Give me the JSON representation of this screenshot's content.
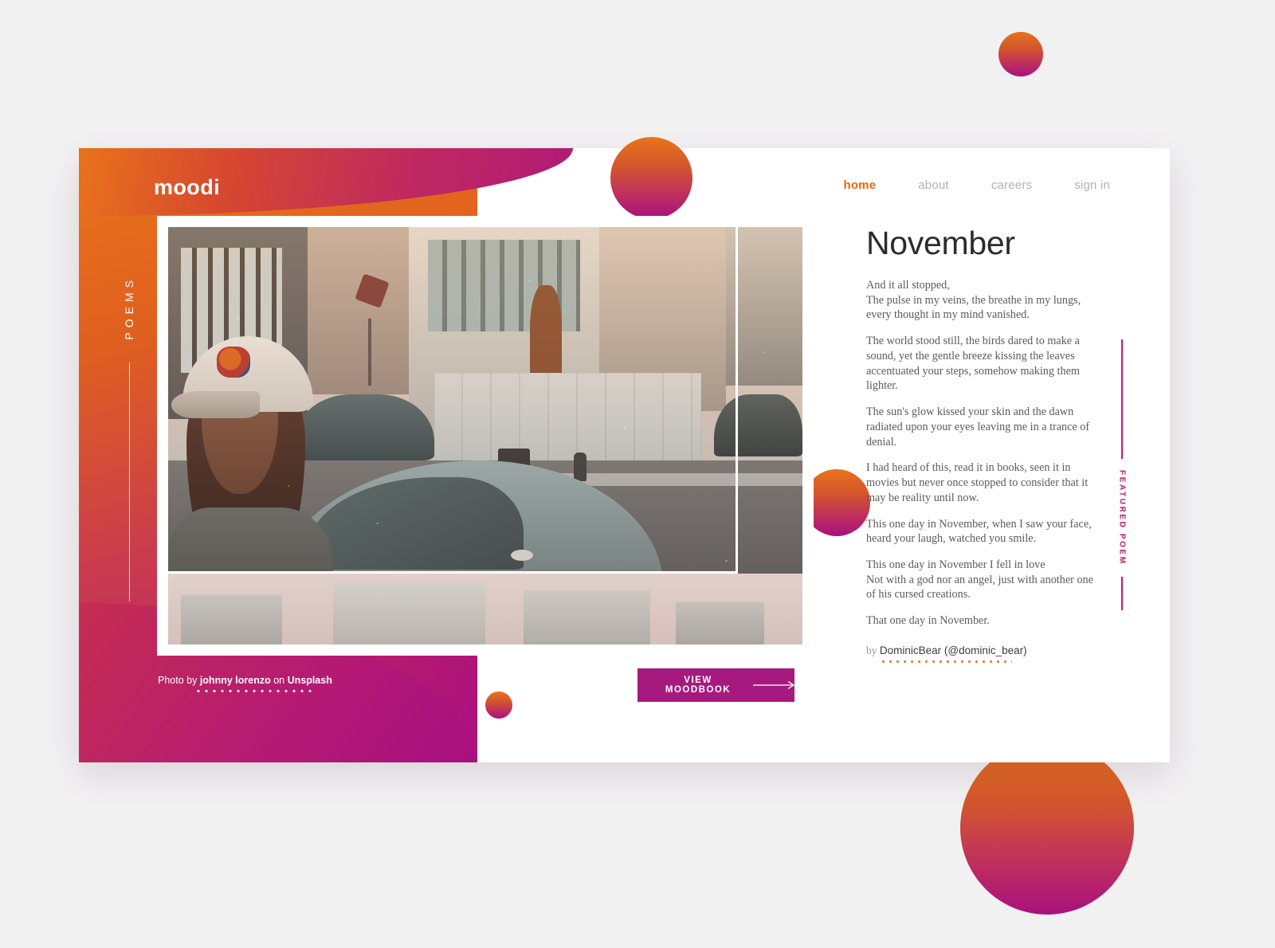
{
  "brand": "moodi",
  "side_rail": {
    "label": "POEMS"
  },
  "nav": {
    "items": [
      {
        "label": "home",
        "active": true
      },
      {
        "label": "about",
        "active": false
      },
      {
        "label": "careers",
        "active": false
      },
      {
        "label": "sign in",
        "active": false
      }
    ]
  },
  "photo_credit": {
    "prefix": "Photo by ",
    "photographer": "johnny lorenzo",
    "middle": " on ",
    "source": "Unsplash"
  },
  "cta": {
    "label": "VIEW MOODBOOK",
    "icon": "arrow-right-icon"
  },
  "featured": {
    "label": "FEATURED POEM"
  },
  "poem": {
    "title": "November",
    "stanzas": [
      "And it all stopped,\nThe pulse in my veins, the breathe in my lungs,\nevery thought in my mind vanished.",
      "The world stood still, the birds dared to make a sound, yet the gentle breeze kissing the leaves accentuated your steps, somehow making them lighter.",
      "The sun's glow kissed your skin and the dawn radiated upon your eyes leaving me in a trance of denial.",
      "I had heard of this, read it in books, seen it in movies but never once stopped to consider that it may be reality until now.",
      "This one day in November, when I saw your face, heard your laugh, watched you smile.",
      "This one day in November I fell in love\nNot with a god nor an angel, just with another one of his cursed creations.",
      "That one day in November."
    ],
    "by_prefix": "by ",
    "author": "DominicBear (@dominic_bear)"
  },
  "colors": {
    "accent_orange": "#ec6608",
    "accent_magenta": "#c2186f",
    "cta_bg": "#a61a7f",
    "page_bg": "#f2f1f2",
    "gradient_start": "#e8731a",
    "gradient_end": "#a8107f"
  }
}
